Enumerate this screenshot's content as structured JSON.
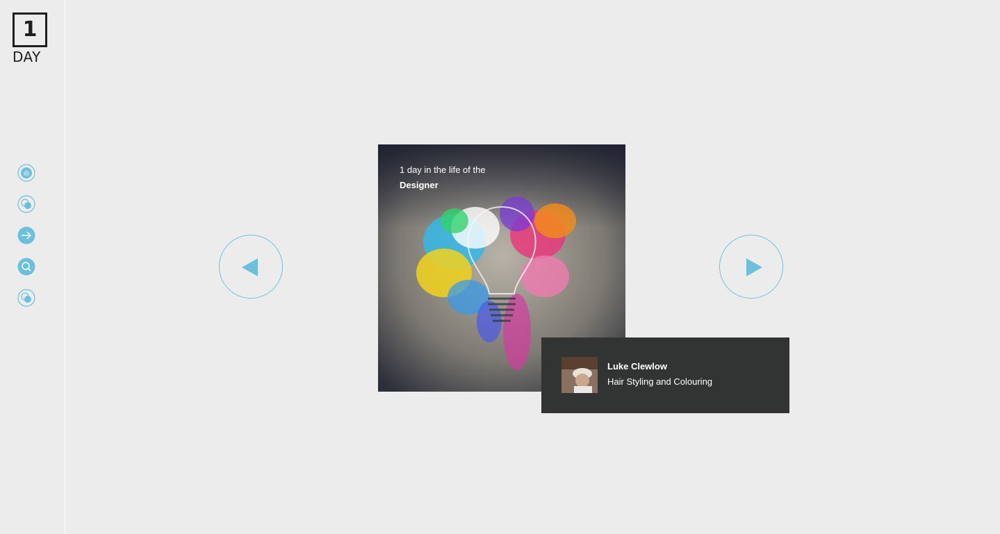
{
  "brand": {
    "logo_number": "1",
    "logo_text": "DAY"
  },
  "sidebar": {
    "items": [
      {
        "icon": "home-icon"
      },
      {
        "icon": "layers-icon"
      },
      {
        "icon": "arrow-right-icon"
      },
      {
        "icon": "search-icon"
      },
      {
        "icon": "layers-icon"
      }
    ]
  },
  "carousel": {
    "prev_icon": "triangle-left-icon",
    "next_icon": "triangle-right-icon",
    "card": {
      "caption": "1 day in the life of the",
      "role": "Designer"
    }
  },
  "person": {
    "name": "Luke Clewlow",
    "title": "Hair Styling and Colouring"
  },
  "colors": {
    "accent": "#6cc0dc",
    "background": "#ececec",
    "info_box": "#323333"
  }
}
